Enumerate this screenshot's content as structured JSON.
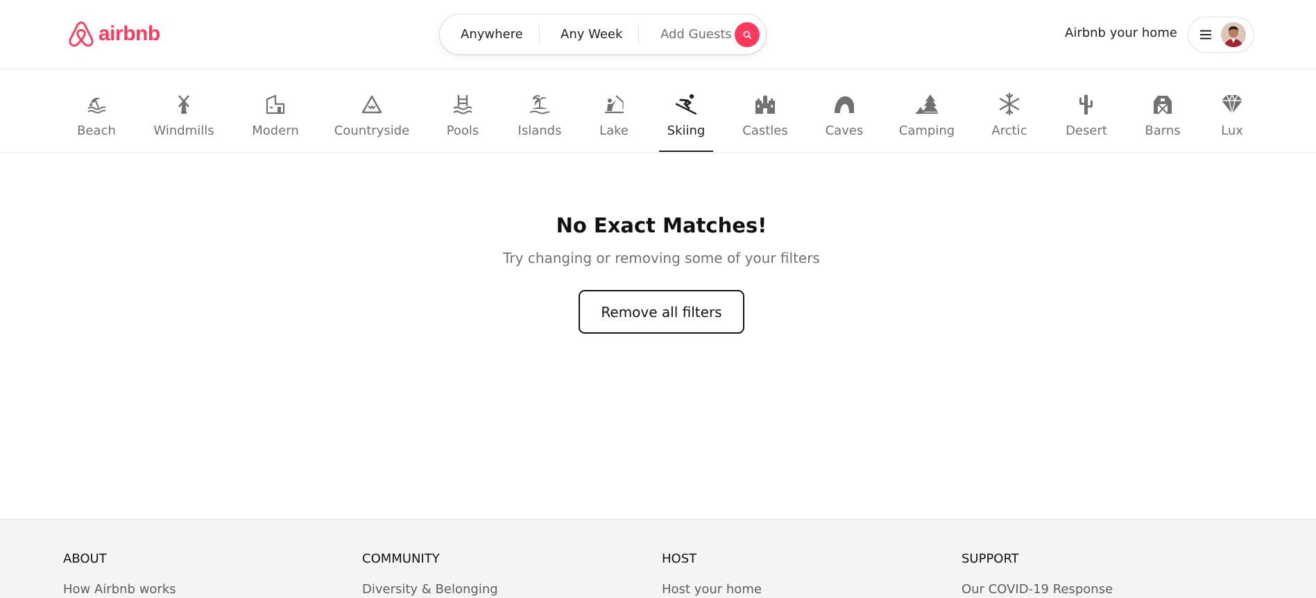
{
  "brand": {
    "name": "airbnb",
    "color": "#FF385C"
  },
  "search": {
    "location": "Anywhere",
    "dates": "Any Week",
    "guests": "Add Guests",
    "button_icon": "search-icon"
  },
  "user_menu": {
    "host_link": "Airbnb your home",
    "menu_icon": "hamburger-icon",
    "avatar_icon": "user-avatar"
  },
  "categories": [
    {
      "label": "Beach",
      "icon": "beach-icon"
    },
    {
      "label": "Windmills",
      "icon": "windmill-icon"
    },
    {
      "label": "Modern",
      "icon": "modern-house-icon"
    },
    {
      "label": "Countryside",
      "icon": "mountain-icon"
    },
    {
      "label": "Pools",
      "icon": "pool-icon"
    },
    {
      "label": "Islands",
      "icon": "island-icon"
    },
    {
      "label": "Lake",
      "icon": "lake-icon"
    },
    {
      "label": "Skiing",
      "icon": "skiing-icon",
      "active": true
    },
    {
      "label": "Castles",
      "icon": "castle-icon"
    },
    {
      "label": "Caves",
      "icon": "cave-icon"
    },
    {
      "label": "Camping",
      "icon": "camping-icon"
    },
    {
      "label": "Arctic",
      "icon": "snowflake-icon"
    },
    {
      "label": "Desert",
      "icon": "cactus-icon"
    },
    {
      "label": "Barns",
      "icon": "barn-icon"
    },
    {
      "label": "Lux",
      "icon": "diamond-icon"
    }
  ],
  "empty_state": {
    "title": "No Exact Matches!",
    "subtitle": "Try changing or removing some of your filters",
    "button": "Remove all filters"
  },
  "footer": {
    "columns": [
      {
        "heading": "ABOUT",
        "first_link": "How Airbnb works"
      },
      {
        "heading": "COMMUNITY",
        "first_link": "Diversity & Belonging"
      },
      {
        "heading": "HOST",
        "first_link": "Host your home"
      },
      {
        "heading": "SUPPORT",
        "first_link": "Our COVID-19 Response"
      }
    ]
  }
}
